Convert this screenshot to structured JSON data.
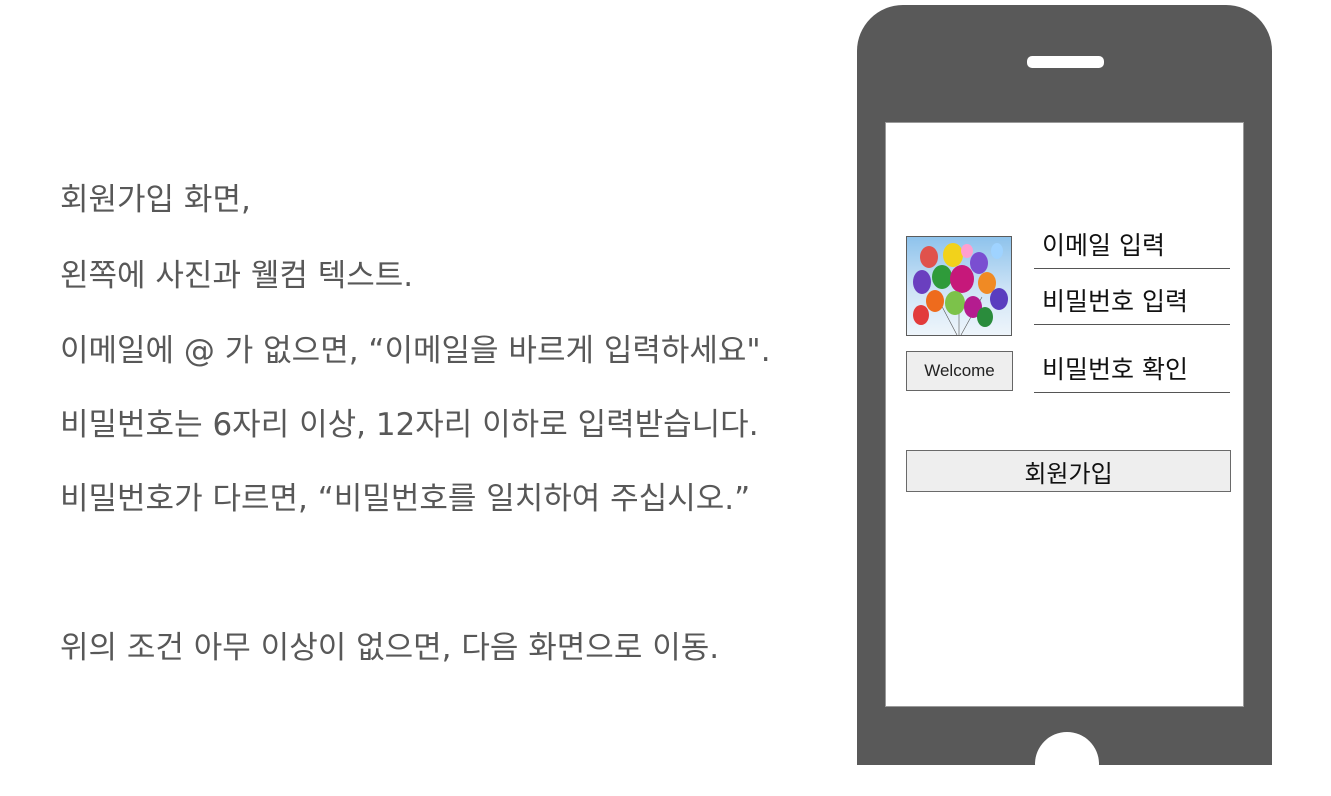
{
  "description": {
    "line1": "회원가입 화면,",
    "line2": "왼쪽에 사진과 웰컴 텍스트.",
    "line3": "이메일에 @ 가 없으면, “이메일을 바르게 입력하세요\".",
    "line4": "비밀번호는 6자리 이상, 12자리 이하로 입력받습니다.",
    "line5": "비밀번호가 다르면, “비밀번호를 일치하여 주십시오.”",
    "line6": "위의 조건 아무 이상이 없으면, 다음 화면으로 이동."
  },
  "phone": {
    "welcome_label": "Welcome",
    "email_placeholder": "이메일 입력",
    "password_placeholder": "비밀번호 입력",
    "password_confirm_placeholder": "비밀번호 확인",
    "signup_label": "회원가입",
    "photo_icon": "balloons-photo"
  },
  "colors": {
    "phone_body": "#595959",
    "text_gray": "#585858",
    "button_bg": "#eeeeee"
  }
}
